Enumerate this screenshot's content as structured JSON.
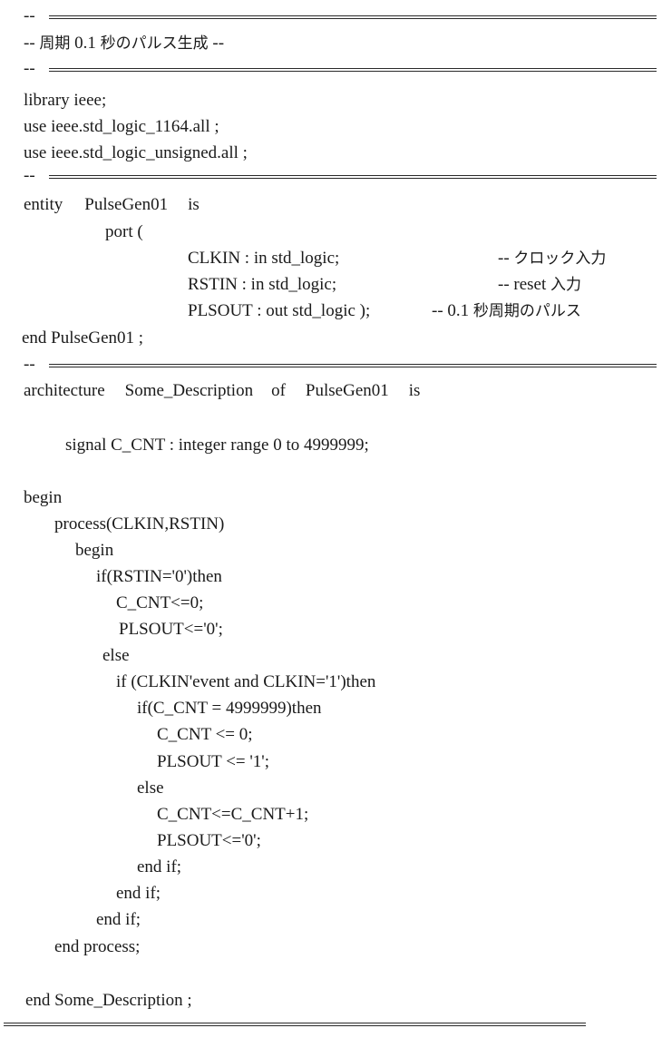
{
  "comment_dash": "--",
  "header": {
    "comment_prefix": "-- ",
    "title_jp": "周期",
    "title_num": " 0.1 ",
    "title_jp2": "秒のパルス生成",
    "comment_suffix": " --"
  },
  "libs": {
    "line1": "library ieee;",
    "line2": "use ieee.std_logic_1164.all ;",
    "line3": "use ieee.std_logic_unsigned.all ;"
  },
  "entity": {
    "decl_kw": "entity",
    "name": "PulseGen01",
    "is_kw": "is",
    "port_open": "port (",
    "ports": [
      {
        "text": "CLKIN : in std_logic;",
        "comment_prefix": "-- ",
        "comment_jp": "クロック入力",
        "comment_en": ""
      },
      {
        "text": "RSTIN : in std_logic;",
        "comment_prefix": "-- ",
        "comment_en": "reset ",
        "comment_jp": "入力"
      },
      {
        "text": "PLSOUT : out std_logic );",
        "comment_prefix": "-- ",
        "comment_en": "0.1 ",
        "comment_jp": "秒周期のパルス"
      }
    ],
    "end_line": "end PulseGen01 ;"
  },
  "architecture": {
    "kw": "architecture",
    "name": "Some_Description",
    "of_kw": "of",
    "entity_name": "PulseGen01",
    "is_kw": "is",
    "signal_line": "signal C_CNT : integer range 0 to 4999999;",
    "body": [
      "begin",
      "process(CLKIN,RSTIN)",
      "begin",
      "if(RSTIN='0')then",
      "C_CNT<=0;",
      "PLSOUT<='0';",
      "else",
      "if (CLKIN'event and CLKIN='1')then",
      "if(C_CNT = 4999999)then",
      "C_CNT <= 0;",
      "PLSOUT <= '1';",
      "else",
      "C_CNT<=C_CNT+1;",
      "PLSOUT<='0';",
      "end if;",
      "end if;",
      "end if;",
      "end process;"
    ],
    "end_line": "end Some_Description ;"
  }
}
